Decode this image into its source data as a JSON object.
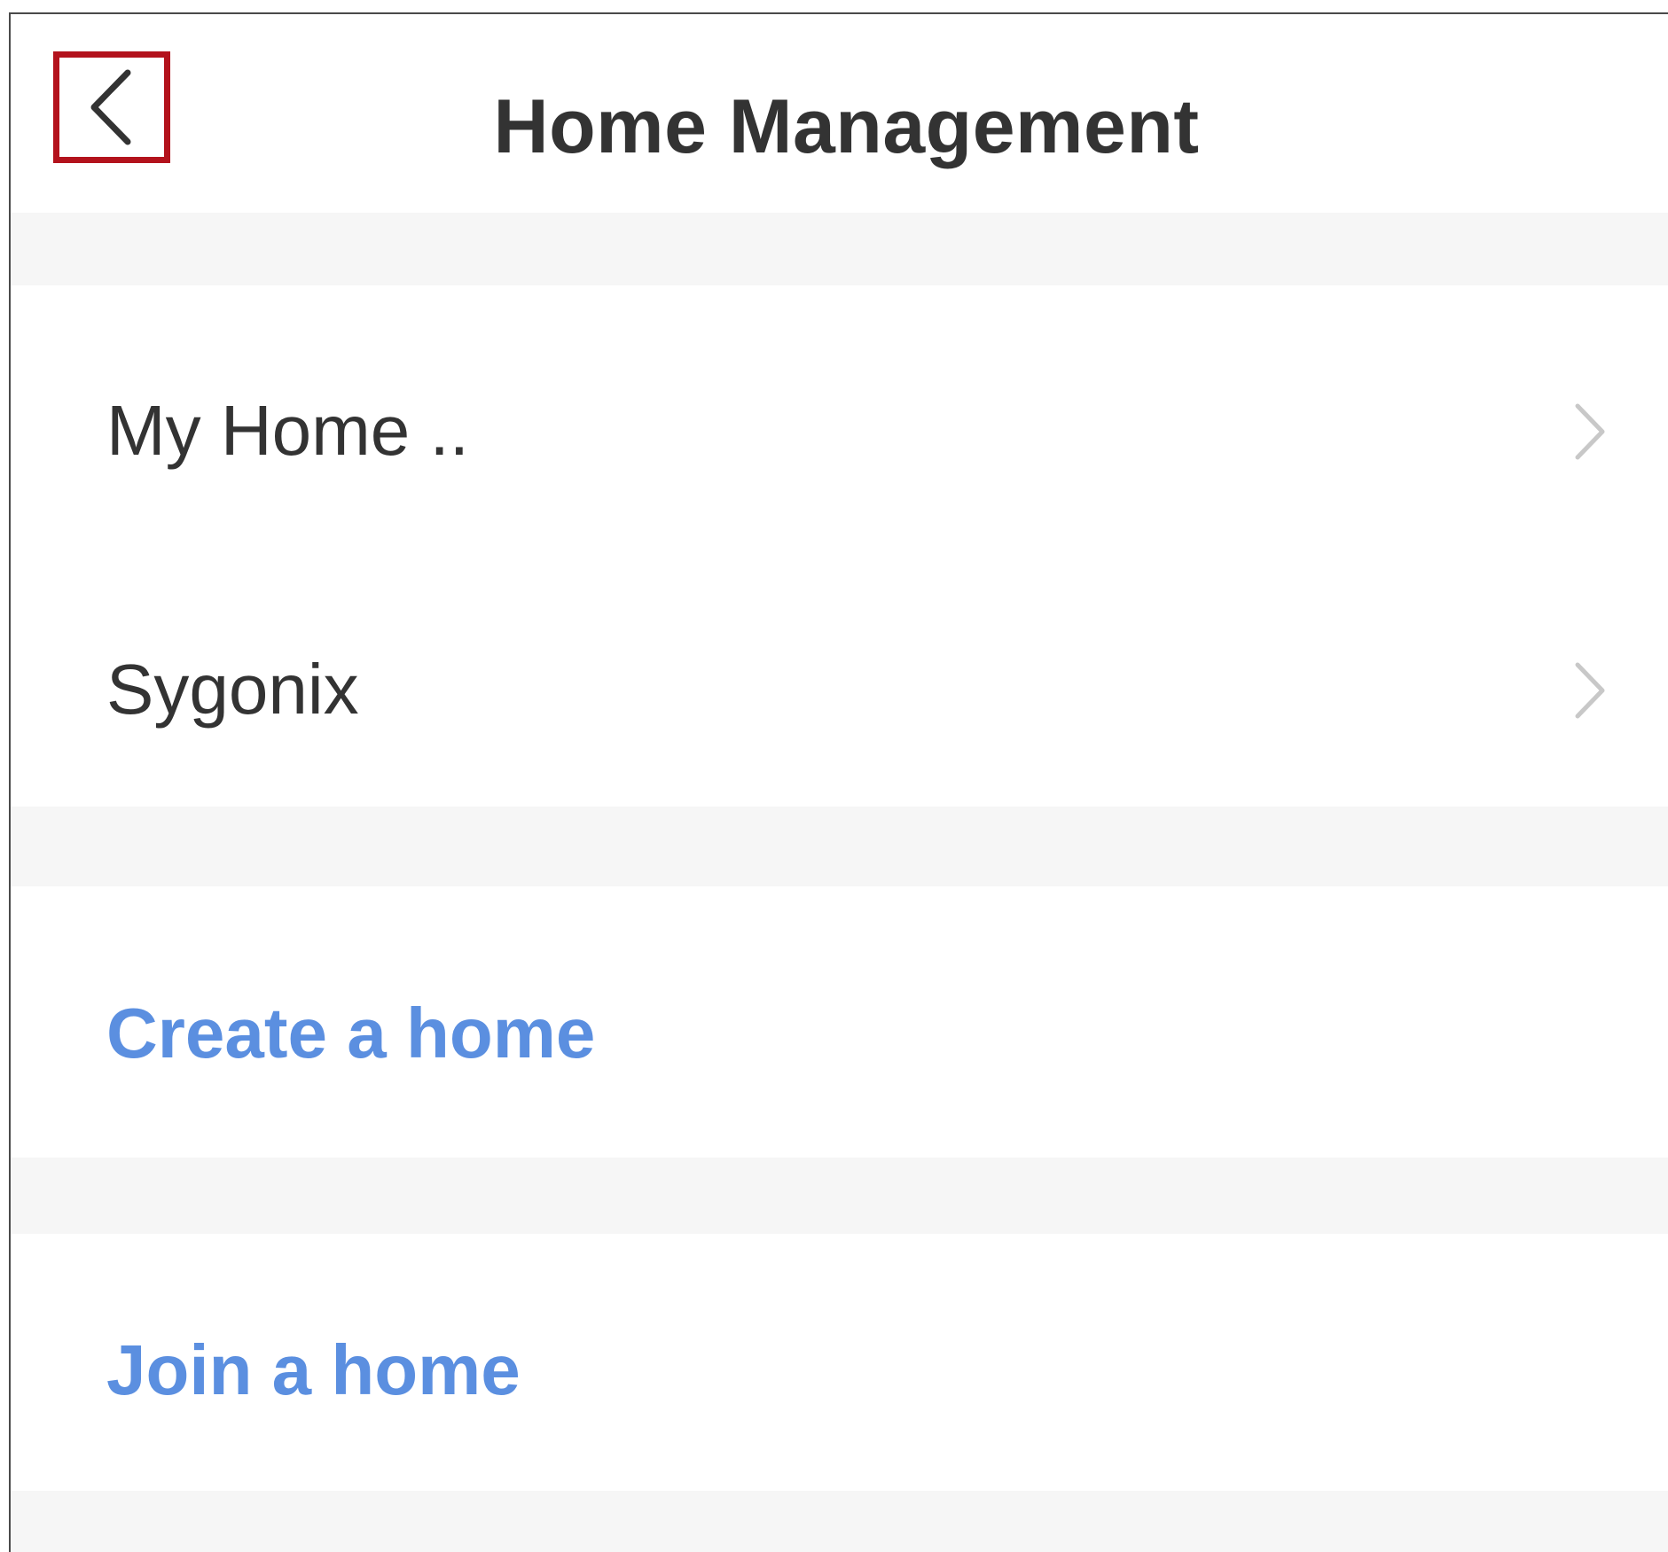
{
  "header": {
    "title": "Home Management",
    "back_icon": "chevron-left-icon",
    "highlight_color": "#b3121c"
  },
  "homes": [
    {
      "label": "My Home ..",
      "icon": "chevron-right-icon"
    },
    {
      "label": "Sygonix",
      "icon": "chevron-right-icon"
    }
  ],
  "actions": {
    "create_label": "Create a home",
    "join_label": "Join a home",
    "link_color": "#5b8fe0"
  }
}
